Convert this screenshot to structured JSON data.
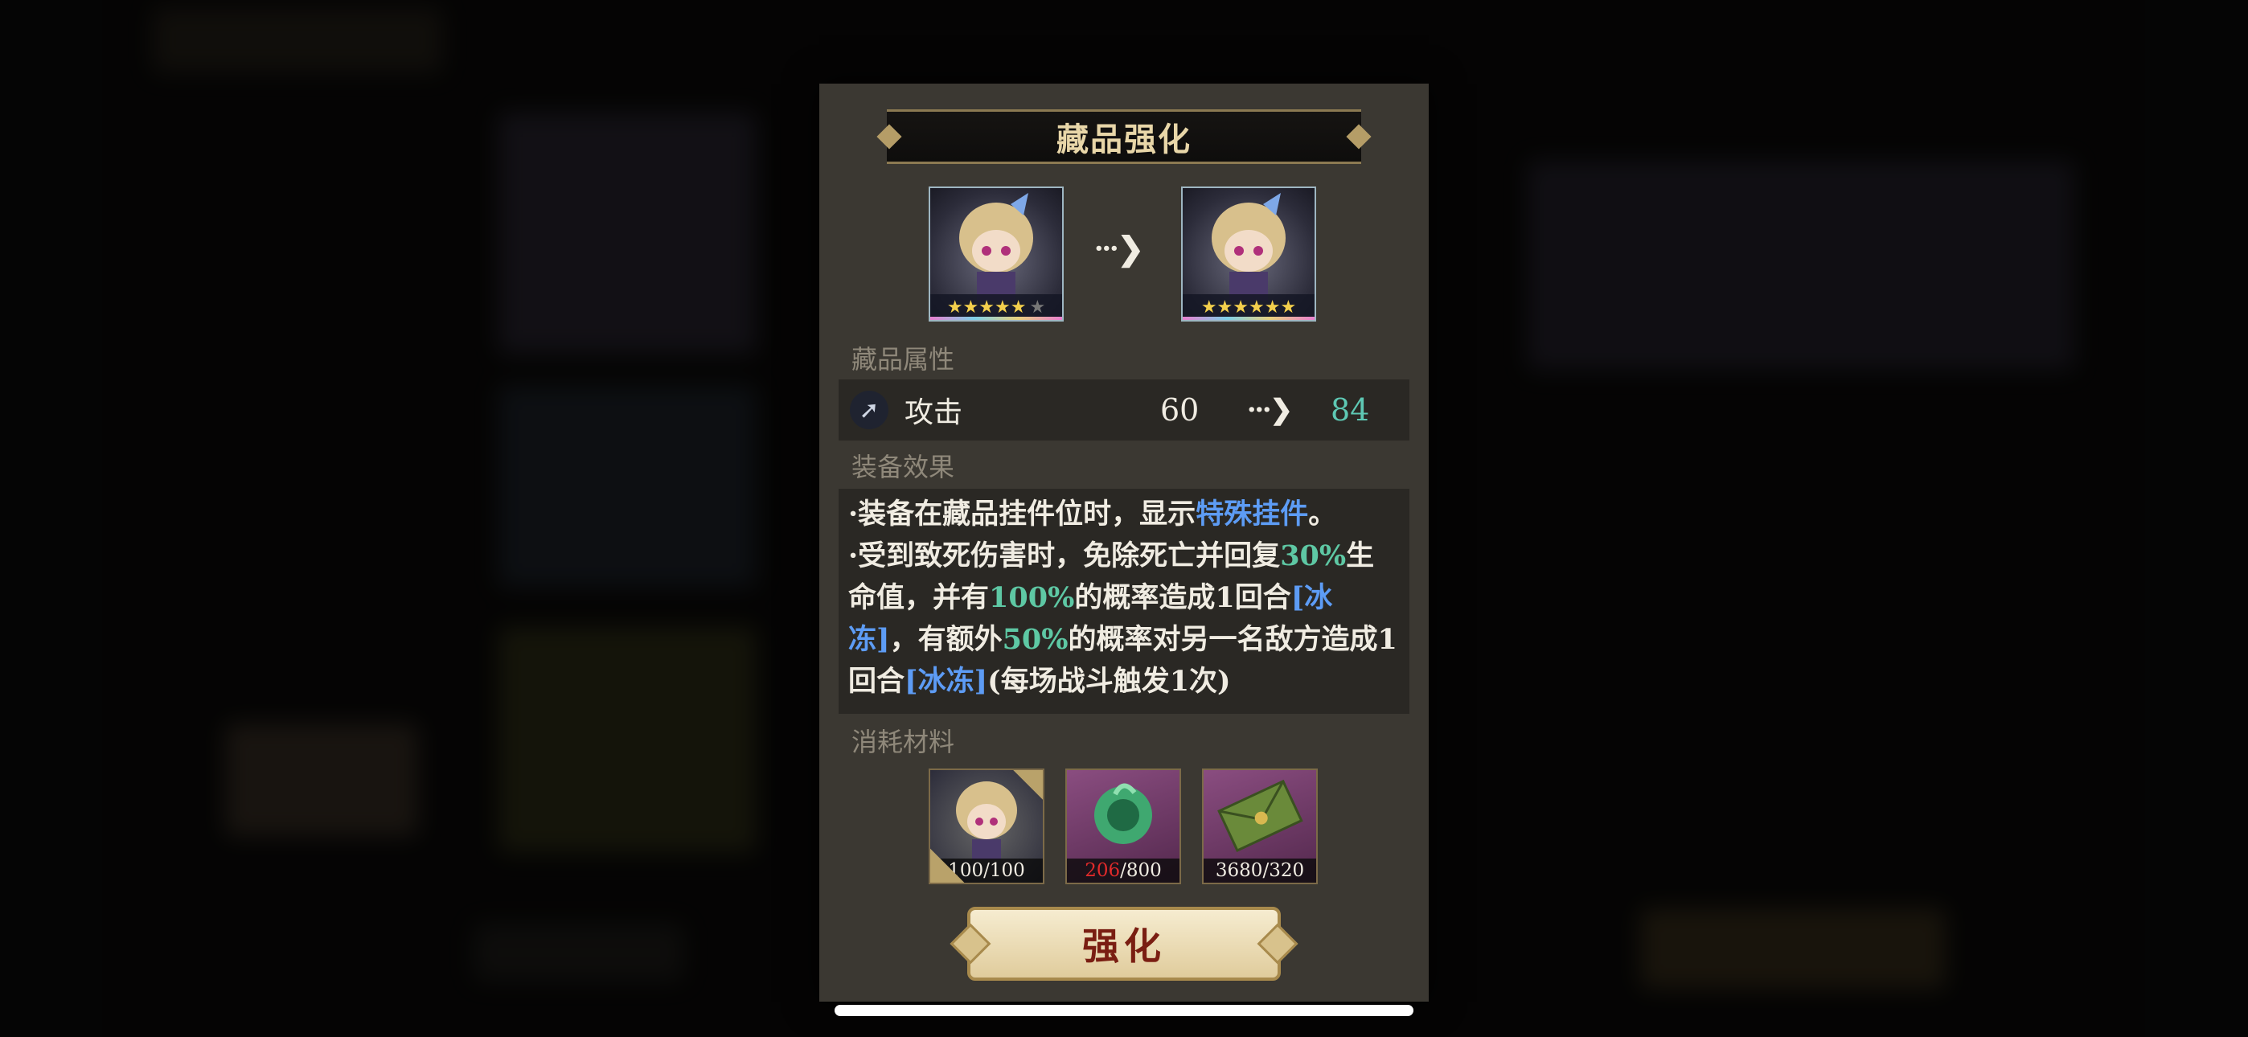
{
  "modal": {
    "title": "藏品强化",
    "arrow_label": "→",
    "before_stars": "★★★★★",
    "before_dim_star": "★",
    "after_stars": "★★★★★★",
    "attributes_label": "藏品属性",
    "stat": {
      "name": "攻击",
      "old": "60",
      "new": "84",
      "icon": "claw-icon"
    },
    "effect_label": "装备效果",
    "effect": {
      "l1a": "·装备在藏品挂件位时，显示",
      "l1b": "特殊挂件",
      "l1c": "。",
      "l2a": "·受到致死伤害时，免除死亡并回复",
      "l2b": "30%",
      "l2c": "生命值，并有",
      "l2d": "100%",
      "l2e": "的概率造成1回合",
      "l2f": "[冰冻]",
      "l3a": "，有额外",
      "l3b": "50%",
      "l3c": "的概率对另一名敌方造成1回合",
      "l3d": "[冰冻]",
      "l3e": "(每场战斗触发1次)"
    },
    "materials_label": "消耗材料",
    "materials": [
      {
        "count": "100/100"
      },
      {
        "have": "206",
        "need": "/800"
      },
      {
        "count": "3680/320"
      }
    ],
    "button": "强化"
  },
  "colors": {
    "accent_green": "#5ec8a4",
    "accent_blue": "#5d9cf5",
    "button_text": "#7a1e12",
    "insufficient": "#e02a2a"
  }
}
